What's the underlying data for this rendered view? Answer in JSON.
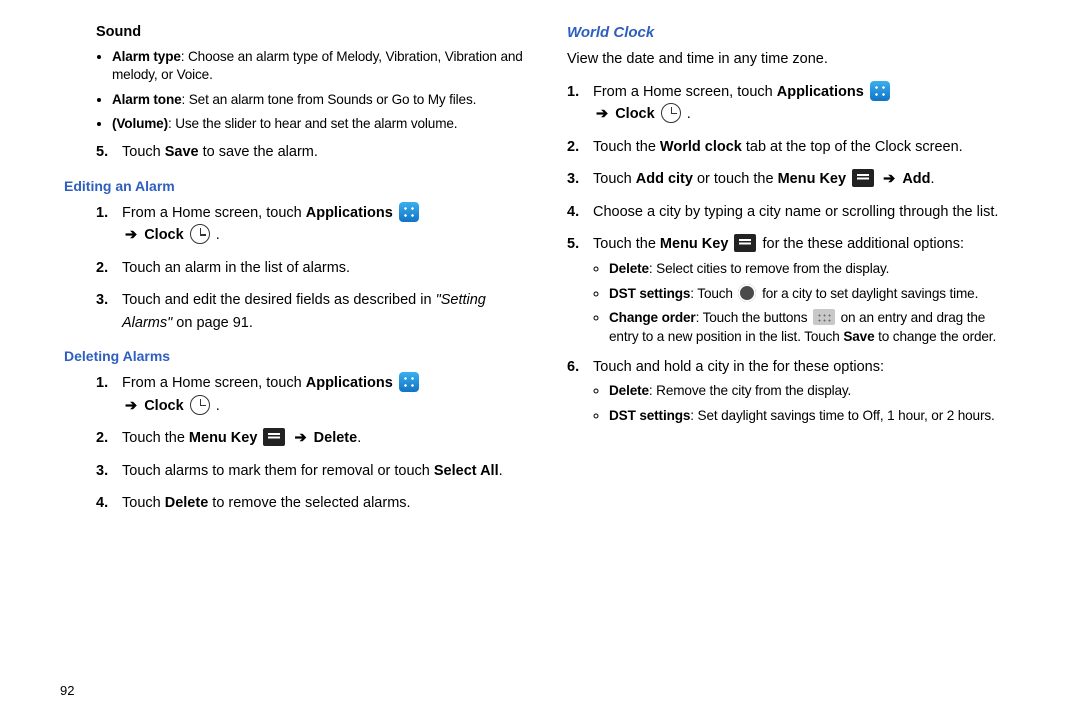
{
  "left": {
    "sound_heading": "Sound",
    "sound_bullets": [
      {
        "label": "Alarm type",
        "text": ": Choose an alarm type of Melody, Vibration, Vibration and melody, or Voice."
      },
      {
        "label": "Alarm tone",
        "text": ": Set an alarm tone from Sounds or Go to My files."
      },
      {
        "label": "(Volume)",
        "text": ": Use the slider to hear and set the alarm volume."
      }
    ],
    "step5_a": "Touch ",
    "step5_b": "Save",
    "step5_c": " to save the alarm.",
    "editing_heading": "Editing an Alarm",
    "edit": {
      "s1_a": "From a Home screen, touch ",
      "s1_b": "Applications",
      "s1_arrow": "➔",
      "s1_clock": "Clock",
      "s1_end": ".",
      "s2": "Touch an alarm in the list of alarms.",
      "s3_a": "Touch and edit the desired fields as described in ",
      "s3_b": "\"Setting Alarms\"",
      "s3_c": " on page 91."
    },
    "deleting_heading": "Deleting Alarms",
    "del": {
      "s1_a": "From a Home screen, touch ",
      "s1_b": "Applications",
      "s1_arrow": "➔",
      "s1_clock": "Clock",
      "s1_end": ".",
      "s2_a": "Touch the ",
      "s2_b": "Menu Key",
      "s2_arrow": "➔",
      "s2_c": "Delete",
      "s2_d": ".",
      "s3_a": "Touch alarms to mark them for removal or touch ",
      "s3_b": "Select All",
      "s3_c": ".",
      "s4_a": "Touch ",
      "s4_b": "Delete",
      "s4_c": " to remove the selected alarms."
    }
  },
  "right": {
    "world_heading": "World Clock",
    "intro": "View the date and time in any time zone.",
    "s1_a": "From a Home screen, touch ",
    "s1_b": "Applications",
    "s1_arrow": "➔",
    "s1_clock": "Clock",
    "s1_end": ".",
    "s2_a": "Touch the ",
    "s2_b": "World clock",
    "s2_c": " tab at the top of the Clock screen.",
    "s3_a": "Touch ",
    "s3_b": "Add city",
    "s3_c": " or touch the ",
    "s3_d": "Menu Key",
    "s3_arrow": "➔",
    "s3_e": "Add",
    "s3_f": ".",
    "s4": "Choose a city by typing a city name or scrolling through the list.",
    "s5_a": "Touch the ",
    "s5_b": "Menu Key",
    "s5_c": " for the these additional options:",
    "s5_bullets": [
      {
        "label": "Delete",
        "text": ": Select cities to remove from the display."
      },
      {
        "label": "DST settings",
        "pre": ": Touch ",
        "post": " for a city to set daylight savings time."
      },
      {
        "label": "Change order",
        "pre": ": Touch the buttons ",
        "post": " on an entry and drag the entry to a new position in the list. Touch ",
        "bold2": "Save",
        "post2": " to change the order."
      }
    ],
    "s6": "Touch and hold a city in the for these options:",
    "s6_bullets": [
      {
        "label": "Delete",
        "text": ": Remove the city from the display."
      },
      {
        "label": "DST settings",
        "text": ": Set daylight savings time to Off, 1 hour, or 2 hours."
      }
    ]
  },
  "page_number": "92"
}
